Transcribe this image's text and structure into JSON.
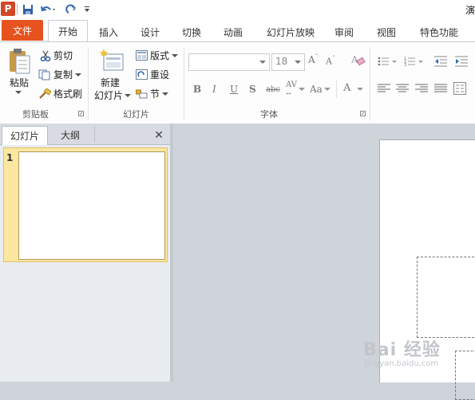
{
  "app": {
    "logo": "P",
    "doc_title": "演"
  },
  "tabs": [
    "文件",
    "开始",
    "插入",
    "设计",
    "切换",
    "动画",
    "幻灯片放映",
    "审阅",
    "视图",
    "特色功能"
  ],
  "clipboard": {
    "paste": "粘贴",
    "cut": "剪切",
    "copy": "复制",
    "format_painter": "格式刷",
    "label": "剪贴板"
  },
  "slides_group": {
    "new_slide_line1": "新建",
    "new_slide_line2": "幻灯片",
    "layout": "版式",
    "reset": "重设",
    "section": "节",
    "label": "幻灯片"
  },
  "font_group": {
    "font_size": "18",
    "label": "字体"
  },
  "pane": {
    "tab_slides": "幻灯片",
    "tab_outline": "大纲",
    "close": "✕",
    "slide_number": "1"
  },
  "watermark": {
    "brand": "Bai 经验",
    "url": "jingyan.baidu.com"
  },
  "colors": {
    "file_tab": "#e6531f",
    "selected_thumb": "#fbe7a0",
    "logo": "#d24726"
  }
}
